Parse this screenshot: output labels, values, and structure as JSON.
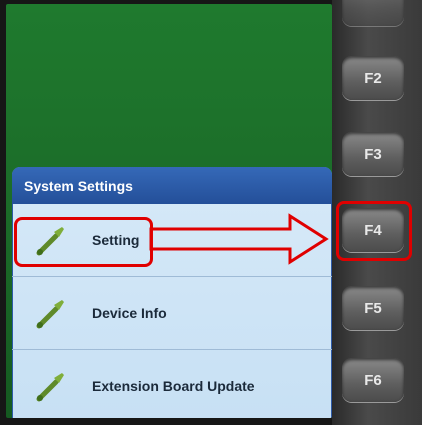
{
  "menu": {
    "title": "System Settings",
    "items": [
      {
        "label": "Setting",
        "icon": "wrench-icon"
      },
      {
        "label": "Device Info",
        "icon": "wrench-icon"
      },
      {
        "label": "Extension Board Update",
        "icon": "wrench-icon"
      }
    ]
  },
  "keypad": {
    "keys": [
      {
        "label": "F2"
      },
      {
        "label": "F3"
      },
      {
        "label": "F4"
      },
      {
        "label": "F5"
      },
      {
        "label": "F6"
      }
    ]
  },
  "annotation": {
    "highlight_color": "#e00000"
  },
  "colors": {
    "screen_green": "#1b6a28",
    "menu_header_blue": "#2d5aa8",
    "menu_body": "#c7e0f4"
  }
}
